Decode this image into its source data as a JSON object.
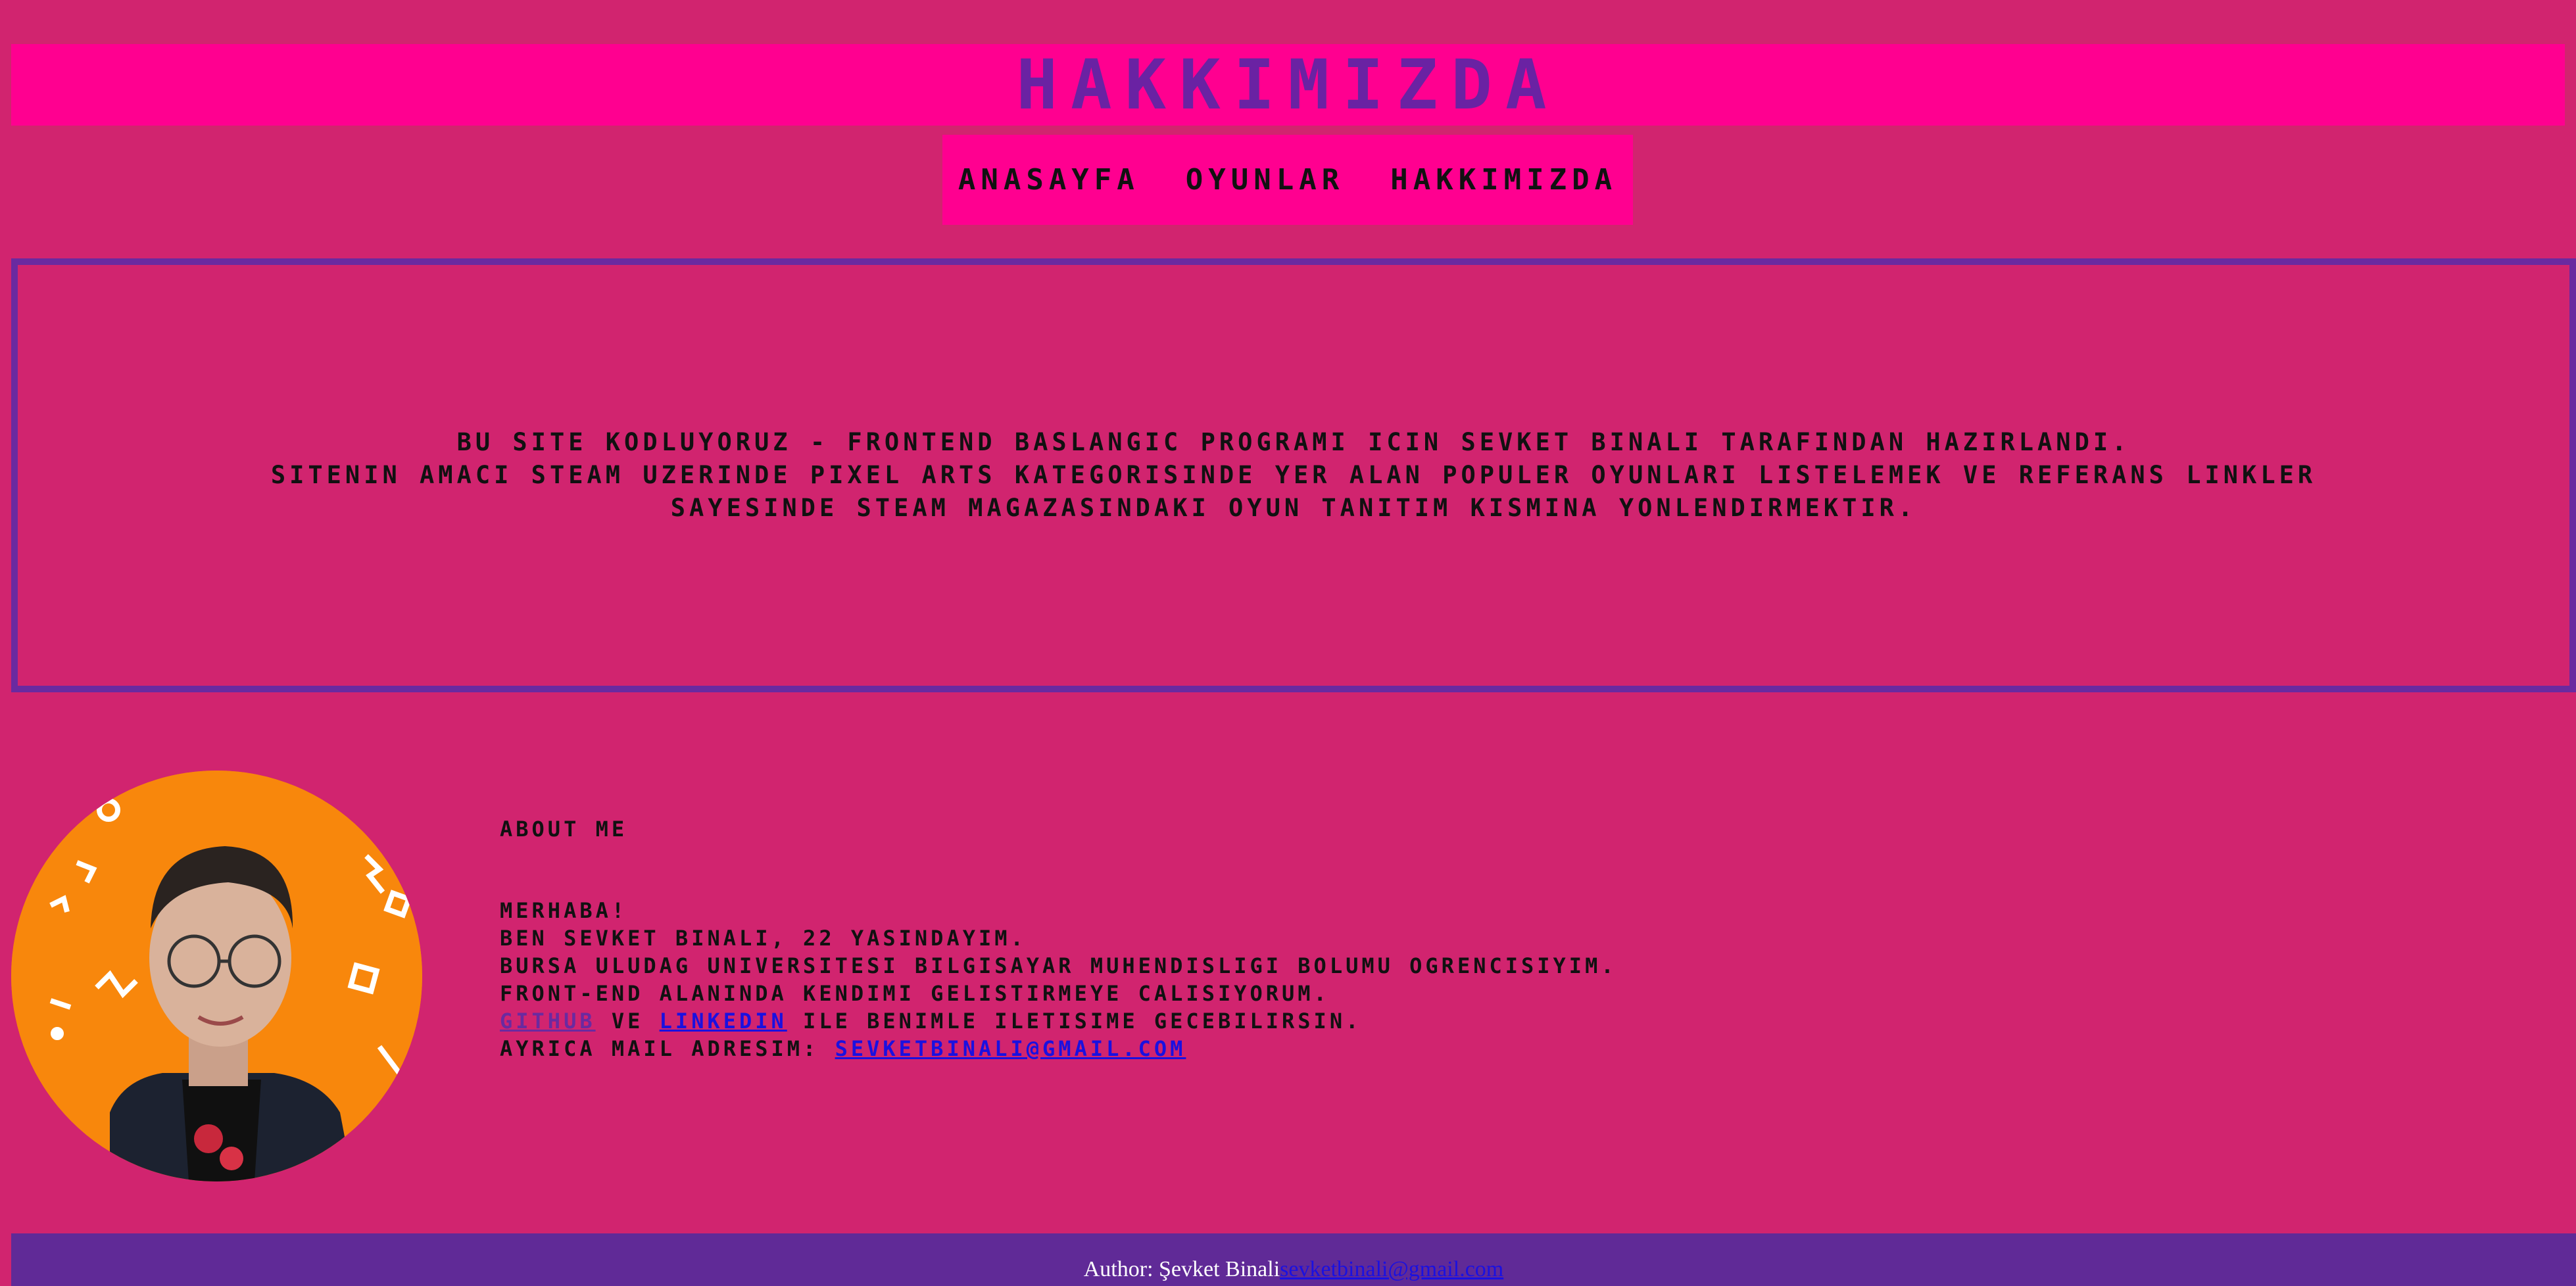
{
  "header": {
    "title": "HAKKIMIZDA"
  },
  "nav": {
    "items": [
      {
        "label": "ANASAYFA"
      },
      {
        "label": "OYUNLAR"
      },
      {
        "label": "HAKKIMIZDA"
      }
    ]
  },
  "intro": {
    "line1": "BU SITE KODLUYORUZ - FRONTEND BASLANGIC PROGRAMI ICIN SEVKET BINALI TARAFINDAN HAZIRLANDI.",
    "line2": "SITENIN AMACI STEAM UZERINDE PIXEL ARTS KATEGORISINDE YER ALAN POPULER OYUNLARI LISTELEMEK VE REFERANS LINKLER SAYESINDE STEAM MAGAZASINDAKI OYUN TANITIM KISMINA YONLENDIRMEKTIR."
  },
  "about": {
    "heading": "ABOUT ME",
    "greeting": "MERHABA!",
    "line_age": "BEN SEVKET BINALI, 22 YASINDAYIM.",
    "line_school": "BURSA ULUDAG UNIVERSITESI BILGISAYAR MUHENDISLIGI BOLUMU OGRENCISIYIM.",
    "line_frontend": "FRONT-END ALANINDA KENDIMI GELISTIRMEYE CALISIYORUM.",
    "github_link": "GITHUB",
    "and_word": " VE ",
    "linkedin_link": "LINKEDIN",
    "contact_rest": " ILE BENIMLE ILETISIME GECEBILIRSIN.",
    "mail_prefix": "AYRICA MAIL ADRESIM: ",
    "mail_link": "SEVKETBINALI@GMAIL.COM"
  },
  "footer": {
    "author_text": "Author: Şevket Binali ",
    "email_link": "sevketbinali@gmail.com"
  },
  "colors": {
    "background": "#d1246f",
    "header_bg": "#ff0090",
    "title": "#6a22a3",
    "border": "#6a2aa0",
    "footer_bg": "#602a97",
    "avatar_bg": "#f8870c"
  }
}
